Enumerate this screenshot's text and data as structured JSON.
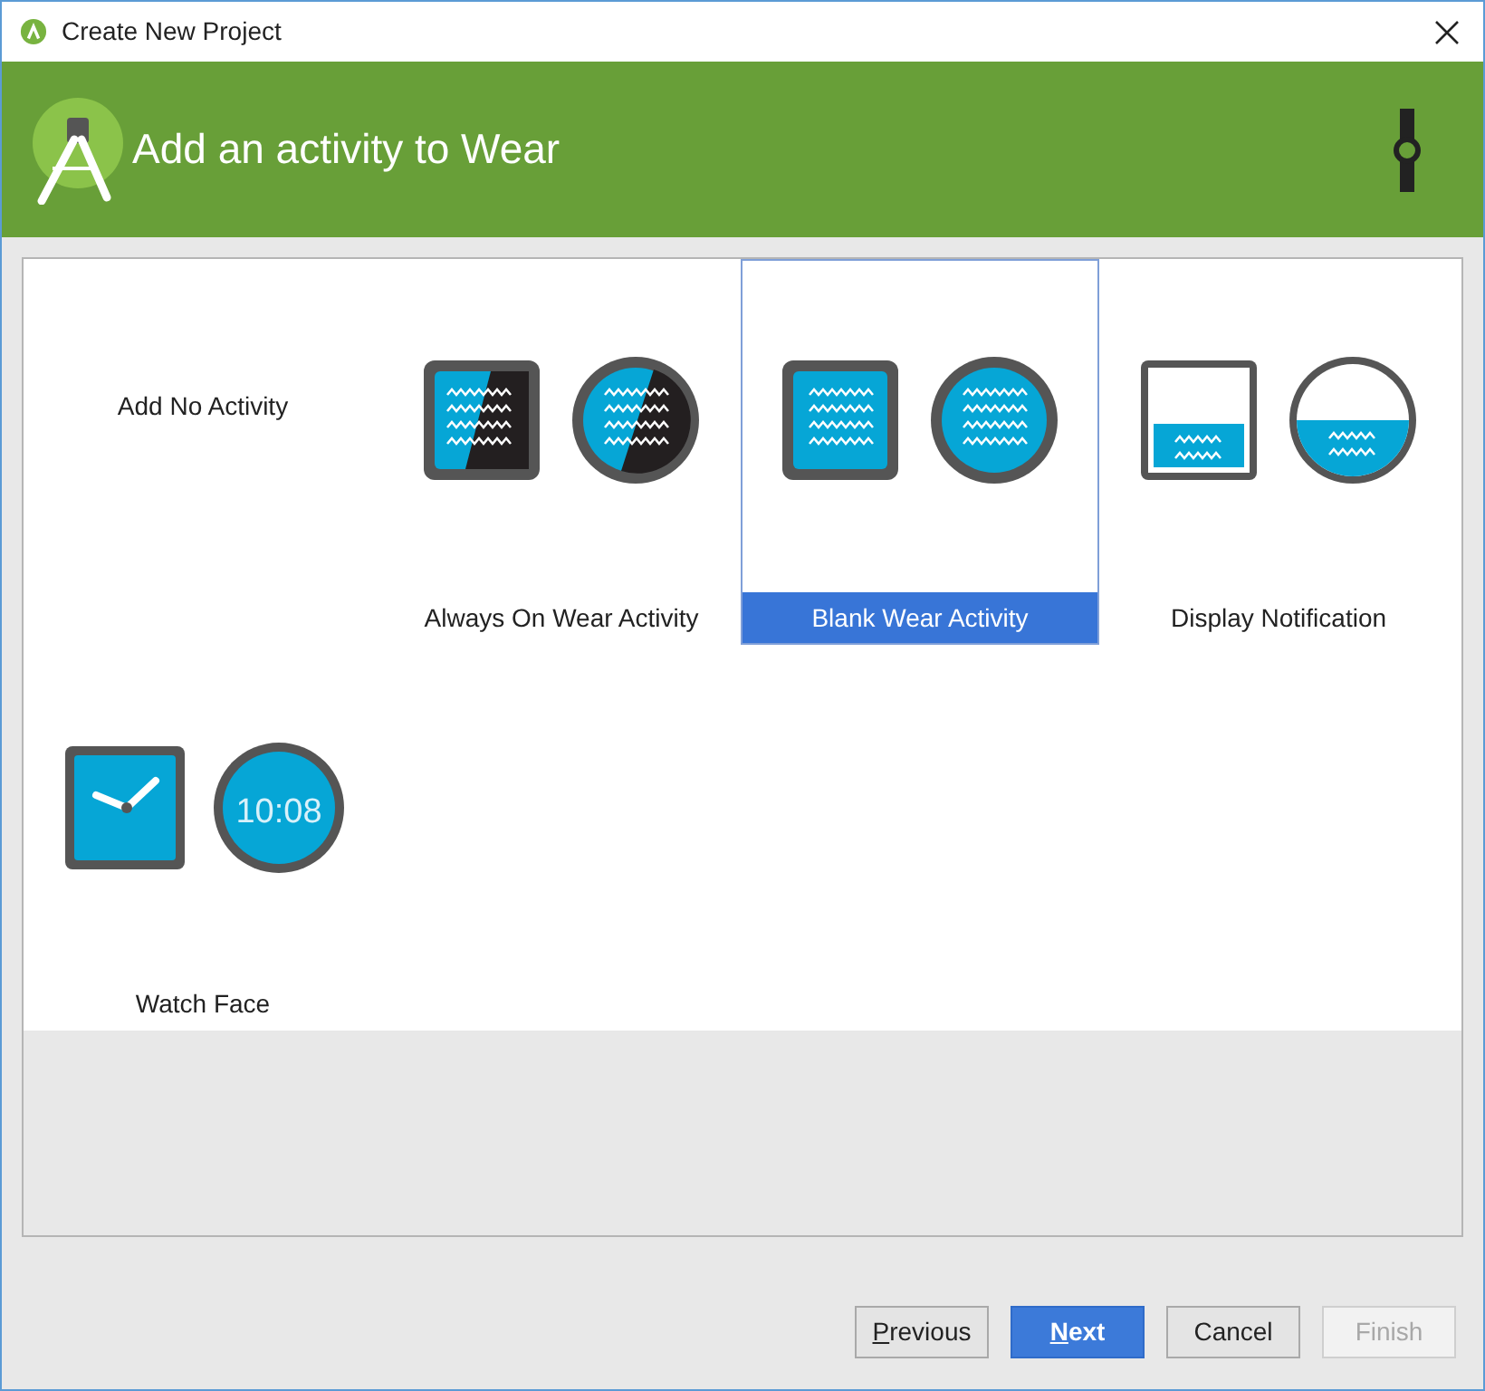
{
  "window": {
    "title": "Create New Project"
  },
  "header": {
    "title": "Add an activity to Wear"
  },
  "templates": [
    {
      "kind": "none",
      "label": "Add No Activity",
      "selected": false
    },
    {
      "kind": "always_on",
      "label": "Always On Wear Activity",
      "selected": false
    },
    {
      "kind": "blank",
      "label": "Blank Wear Activity",
      "selected": true
    },
    {
      "kind": "notification",
      "label": "Display Notification",
      "selected": false
    },
    {
      "kind": "watch_face",
      "label": "Watch Face",
      "selected": false,
      "clock_text": "10:08"
    }
  ],
  "buttons": [
    {
      "label": "Previous",
      "kind": "normal",
      "mnemonic": true,
      "disabled": false
    },
    {
      "label": "Next",
      "kind": "default",
      "mnemonic": true,
      "disabled": false
    },
    {
      "label": "Cancel",
      "kind": "normal",
      "mnemonic": false,
      "disabled": false
    },
    {
      "label": "Finish",
      "kind": "normal",
      "mnemonic": false,
      "disabled": true
    }
  ]
}
